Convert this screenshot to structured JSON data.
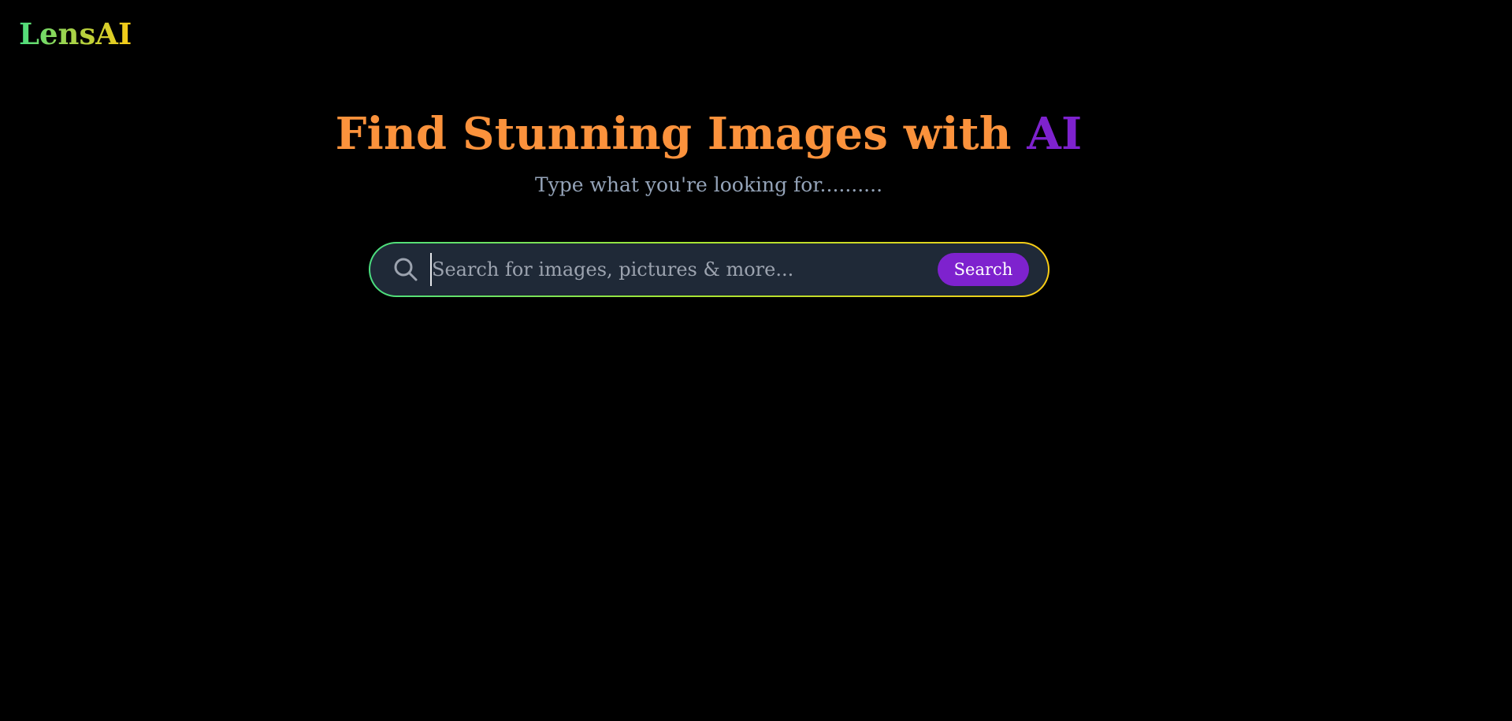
{
  "brand": {
    "logo_text": "LensAI"
  },
  "hero": {
    "title_main": "Find Stunning Images with ",
    "title_accent": "AI",
    "subtitle": "Type what you're looking for.........."
  },
  "search": {
    "placeholder": "Search for images, pictures & more...",
    "value": "",
    "button_label": "Search",
    "icon": "search-icon"
  },
  "colors": {
    "background": "#000000",
    "title": "#fb923c",
    "accent": "#7e22ce",
    "subtitle": "#94a3b8",
    "search_field": "#1f2937",
    "gradient_start": "#4ade80",
    "gradient_end": "#facc15"
  }
}
